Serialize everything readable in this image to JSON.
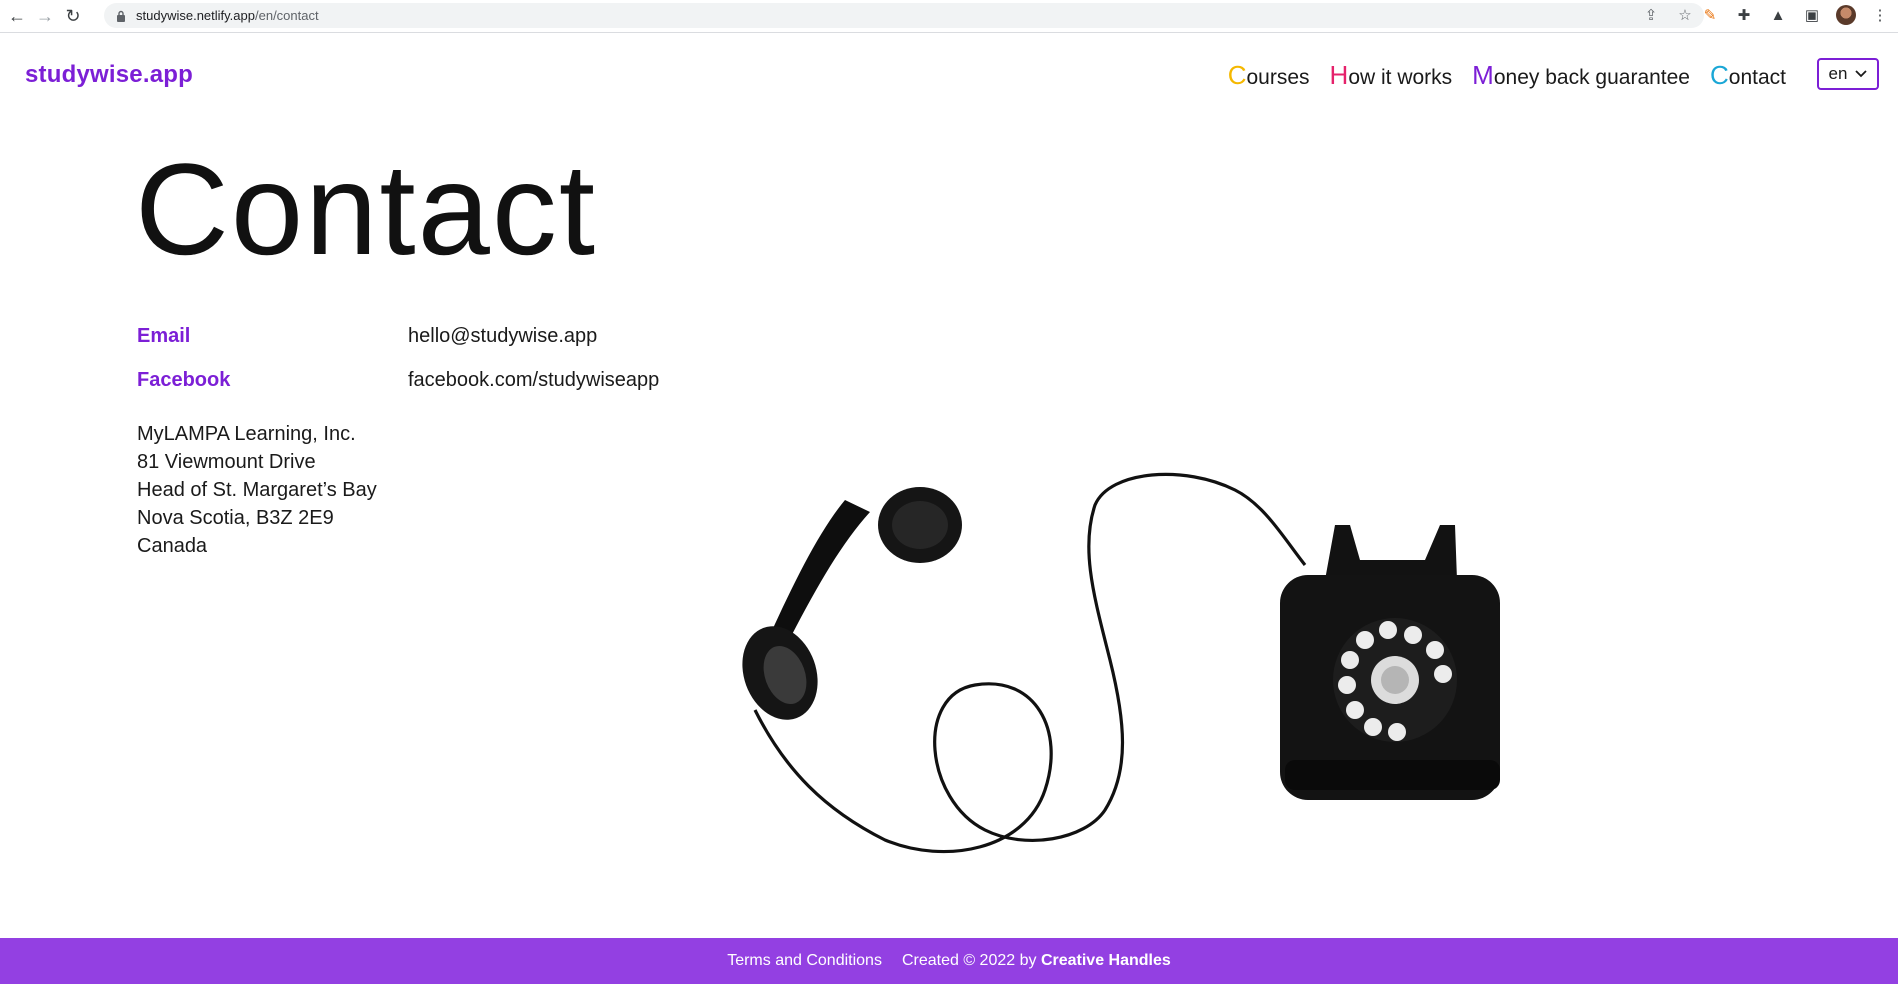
{
  "browser": {
    "url_host": "studywise.netlify.app",
    "url_path": "/en/contact",
    "icons": [
      "back-arrow-icon",
      "forward-arrow-icon",
      "reload-icon",
      "lock-icon",
      "share-icon",
      "bookmark-star-icon",
      "extension-icon",
      "puzzle-icon",
      "flask-icon",
      "sidebar-icon",
      "avatar",
      "kebab-menu-icon"
    ]
  },
  "header": {
    "logo": "studywise.app",
    "nav": [
      {
        "initial": "C",
        "rest": "ourses",
        "initial_color": "#f5b800"
      },
      {
        "initial": "H",
        "rest": "ow it works",
        "initial_color": "#e5226b"
      },
      {
        "initial": "M",
        "rest": "oney back guarantee",
        "initial_color": "#7c1fd6"
      },
      {
        "initial": "C",
        "rest": "ontact",
        "initial_color": "#1ba7d6"
      }
    ],
    "language": "en"
  },
  "page": {
    "title": "Contact",
    "email_label": "Email",
    "email_value": "hello@studywise.app",
    "facebook_label": "Facebook",
    "facebook_value": "facebook.com/studywiseapp",
    "address": [
      "MyLAMPA Learning, Inc.",
      "81 Viewmount Drive",
      "Head of St. Margaret’s Bay",
      "Nova Scotia, B3Z 2E9",
      "Canada"
    ]
  },
  "footer": {
    "terms": "Terms and Conditions",
    "created_prefix": "Created © 2022 by",
    "created_by": "Creative Handles"
  },
  "colors": {
    "brand": "#7c1fd6",
    "footer": "#9340e2"
  }
}
